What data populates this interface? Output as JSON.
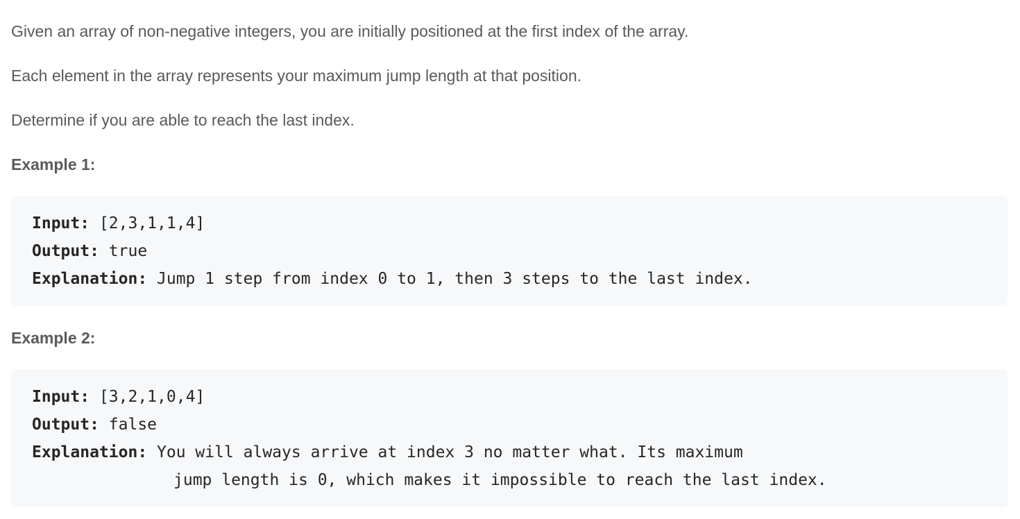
{
  "description": {
    "p1": "Given an array of non-negative integers, you are initially positioned at the first index of the array.",
    "p2": "Each element in the array represents your maximum jump length at that position.",
    "p3": "Determine if you are able to reach the last index."
  },
  "examples": [
    {
      "heading": "Example 1:",
      "input_label": "Input:",
      "input_value": " [2,3,1,1,4]",
      "output_label": "Output:",
      "output_value": " true",
      "explanation_label": "Explanation:",
      "explanation_line1": " Jump 1 step from index 0 to 1, then 3 steps to the last index."
    },
    {
      "heading": "Example 2:",
      "input_label": "Input:",
      "input_value": " [3,2,1,0,4]",
      "output_label": "Output:",
      "output_value": " false",
      "explanation_label": "Explanation:",
      "explanation_line1": " You will always arrive at index 3 no matter what. Its maximum",
      "explanation_line2": "jump length is 0, which makes it impossible to reach the last index."
    }
  ]
}
